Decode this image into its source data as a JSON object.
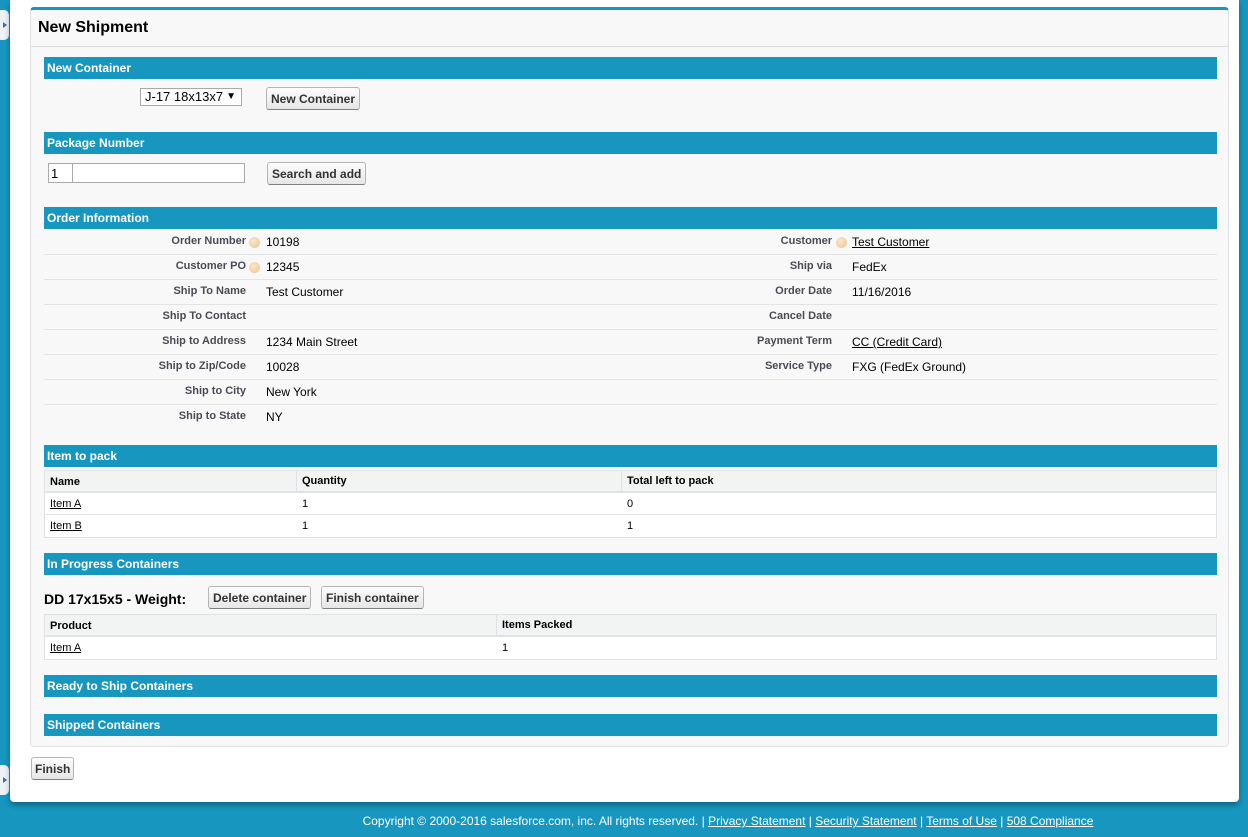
{
  "page": {
    "title": "New Shipment",
    "finish_label": "Finish"
  },
  "new_container": {
    "header": "New Container",
    "selected_container": "J-17 18x13x7",
    "button_label": "New Container"
  },
  "package_number": {
    "header": "Package Number",
    "prefix_value": "1",
    "search_value": "",
    "button_label": "Search and add"
  },
  "order_information": {
    "header": "Order Information",
    "left_fields": [
      {
        "label": "Order Number",
        "value": "10198",
        "help": true,
        "link": false
      },
      {
        "label": "Customer PO",
        "value": "12345",
        "help": true,
        "link": false
      },
      {
        "label": "Ship To Name",
        "value": "Test Customer",
        "help": false,
        "link": false
      },
      {
        "label": "Ship To Contact",
        "value": "",
        "help": false,
        "link": false
      },
      {
        "label": "Ship to Address",
        "value": "1234 Main Street",
        "help": false,
        "link": false
      },
      {
        "label": "Ship to Zip/Code",
        "value": "10028",
        "help": false,
        "link": false
      },
      {
        "label": "Ship to City",
        "value": "New York",
        "help": false,
        "link": false
      },
      {
        "label": "Ship to State",
        "value": "NY",
        "help": false,
        "link": false
      }
    ],
    "right_fields": [
      {
        "label": "Customer",
        "value": "Test Customer",
        "help": true,
        "link": true
      },
      {
        "label": "Ship via",
        "value": "FedEx",
        "help": false,
        "link": false
      },
      {
        "label": "Order Date",
        "value": "11/16/2016",
        "help": false,
        "link": false
      },
      {
        "label": "Cancel Date",
        "value": "",
        "help": false,
        "link": false
      },
      {
        "label": "Payment Term",
        "value": "CC (Credit Card)",
        "help": false,
        "link": true
      },
      {
        "label": "Service Type",
        "value": "FXG (FedEx Ground)",
        "help": false,
        "link": false
      }
    ]
  },
  "items_to_pack": {
    "header": "Item to pack",
    "columns": [
      "Name",
      "Quantity",
      "Total left to pack"
    ],
    "rows": [
      {
        "name": "Item A",
        "quantity": "1",
        "left": "0"
      },
      {
        "name": "Item B",
        "quantity": "1",
        "left": "1"
      }
    ]
  },
  "in_progress": {
    "header": "In Progress Containers",
    "container_title": "DD 17x15x5 - Weight:",
    "delete_label": "Delete container",
    "finish_label": "Finish container",
    "columns": [
      "Product",
      "Items Packed"
    ],
    "rows": [
      {
        "product": "Item A",
        "packed": "1"
      }
    ]
  },
  "ready_to_ship": {
    "header": "Ready to Ship Containers"
  },
  "shipped": {
    "header": "Shipped Containers"
  },
  "footer": {
    "copyright": "Copyright © 2000-2016 salesforce.com, inc. All rights reserved. |",
    "links": [
      "Privacy Statement",
      "Security Statement",
      "Terms of Use",
      "508 Compliance"
    ]
  }
}
